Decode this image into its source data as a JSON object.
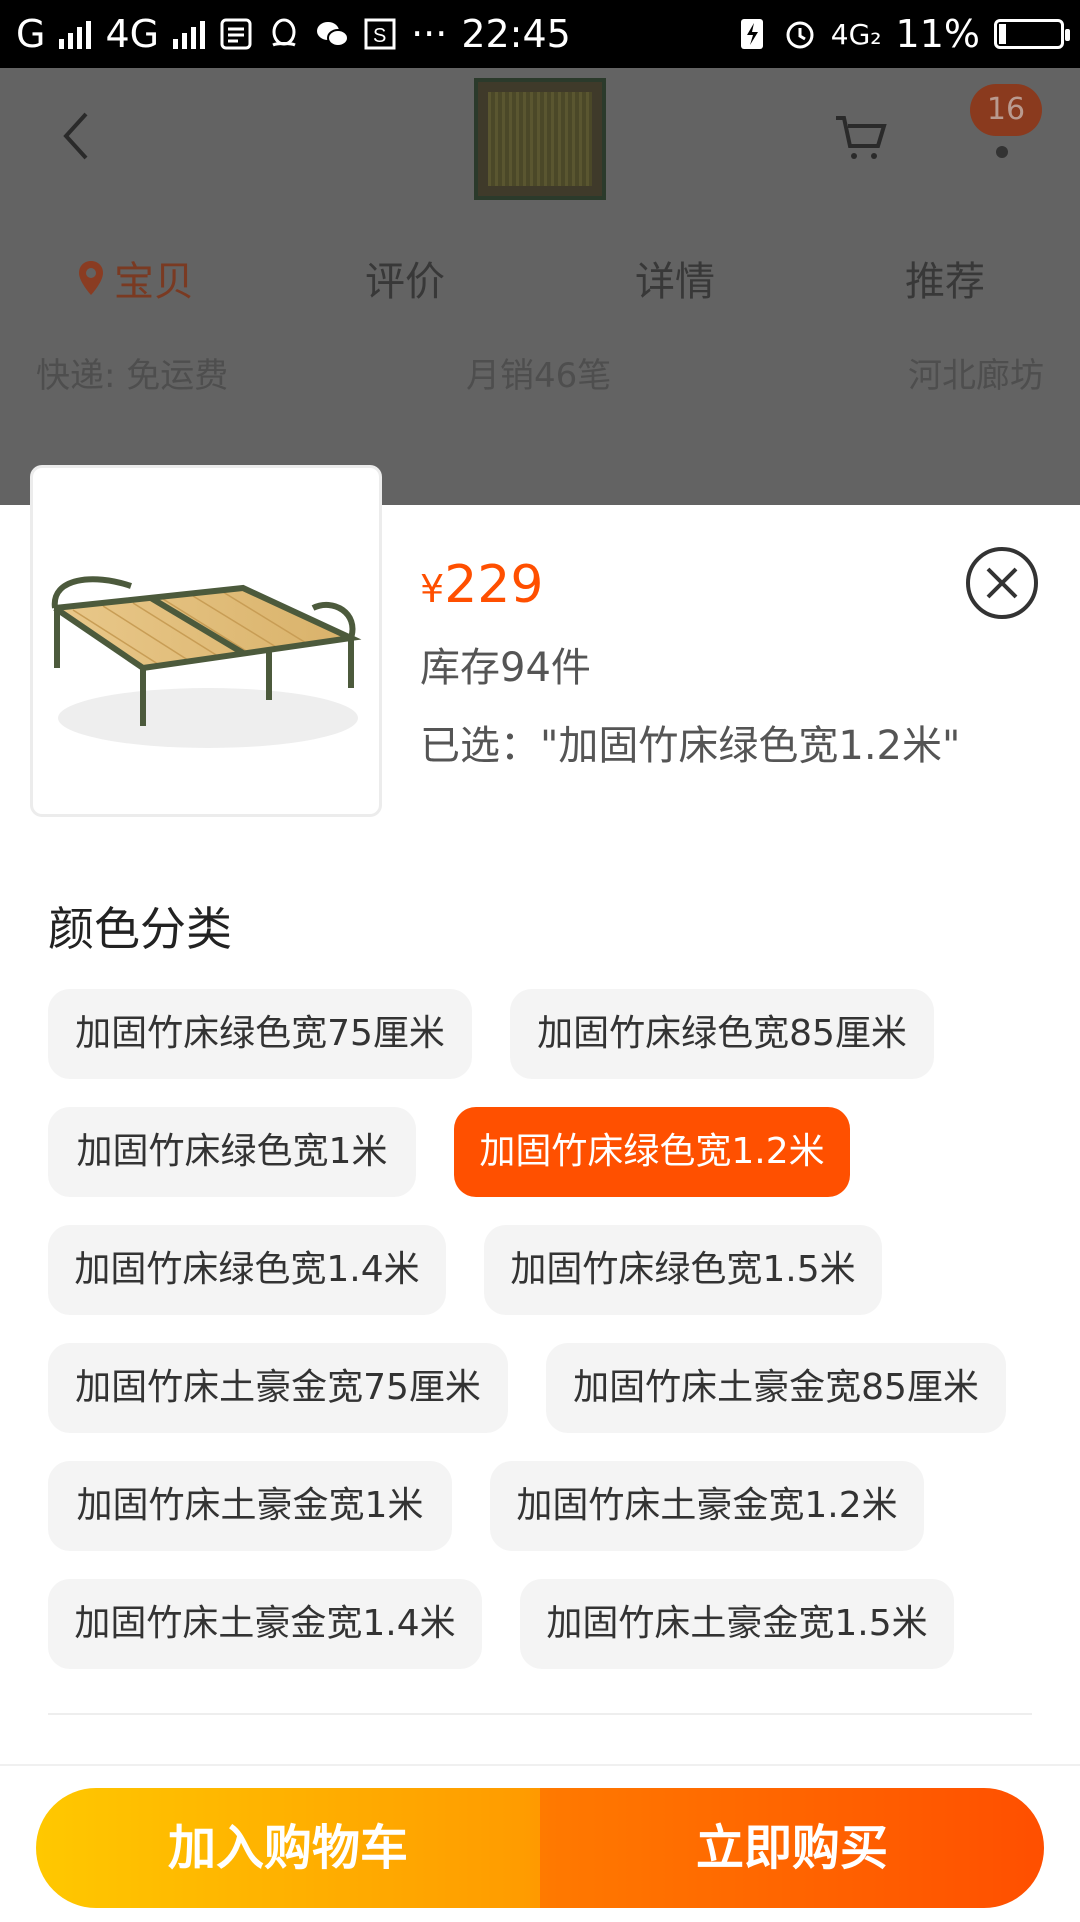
{
  "status_bar": {
    "carrier1": "G",
    "carrier2": "4G",
    "time": "22:45",
    "network": "4G₂",
    "battery": "11%",
    "battery_level": 0.11,
    "dots": "···"
  },
  "header": {
    "cart_badge": "16",
    "tabs": [
      {
        "label": "宝贝",
        "active": true
      },
      {
        "label": "评价",
        "active": false
      },
      {
        "label": "详情",
        "active": false
      },
      {
        "label": "推荐",
        "active": false
      }
    ]
  },
  "info": {
    "shipping": "快递: 免运费",
    "monthly_sales": "月销46笔",
    "location": "河北廊坊"
  },
  "sku_sheet": {
    "price_symbol": "¥",
    "price": "229",
    "stock": "库存94件",
    "selected": "已选：\"加固竹床绿色宽1.2米\"",
    "section_title": "颜色分类",
    "options": [
      {
        "label": "加固竹床绿色宽75厘米",
        "selected": false
      },
      {
        "label": "加固竹床绿色宽85厘米",
        "selected": false
      },
      {
        "label": "加固竹床绿色宽1米",
        "selected": false
      },
      {
        "label": "加固竹床绿色宽1.2米",
        "selected": true
      },
      {
        "label": "加固竹床绿色宽1.4米",
        "selected": false
      },
      {
        "label": "加固竹床绿色宽1.5米",
        "selected": false
      },
      {
        "label": "加固竹床土豪金宽75厘米",
        "selected": false
      },
      {
        "label": "加固竹床土豪金宽85厘米",
        "selected": false
      },
      {
        "label": "加固竹床土豪金宽1米",
        "selected": false
      },
      {
        "label": "加固竹床土豪金宽1.2米",
        "selected": false
      },
      {
        "label": "加固竹床土豪金宽1.4米",
        "selected": false
      },
      {
        "label": "加固竹床土豪金宽1.5米",
        "selected": false
      }
    ]
  },
  "actions": {
    "add_to_cart": "加入购物车",
    "buy_now": "立即购买"
  },
  "colors": {
    "accent": "#ff5000",
    "cart_gradient_start": "#ffc800",
    "buy_gradient_end": "#ff4f00"
  }
}
